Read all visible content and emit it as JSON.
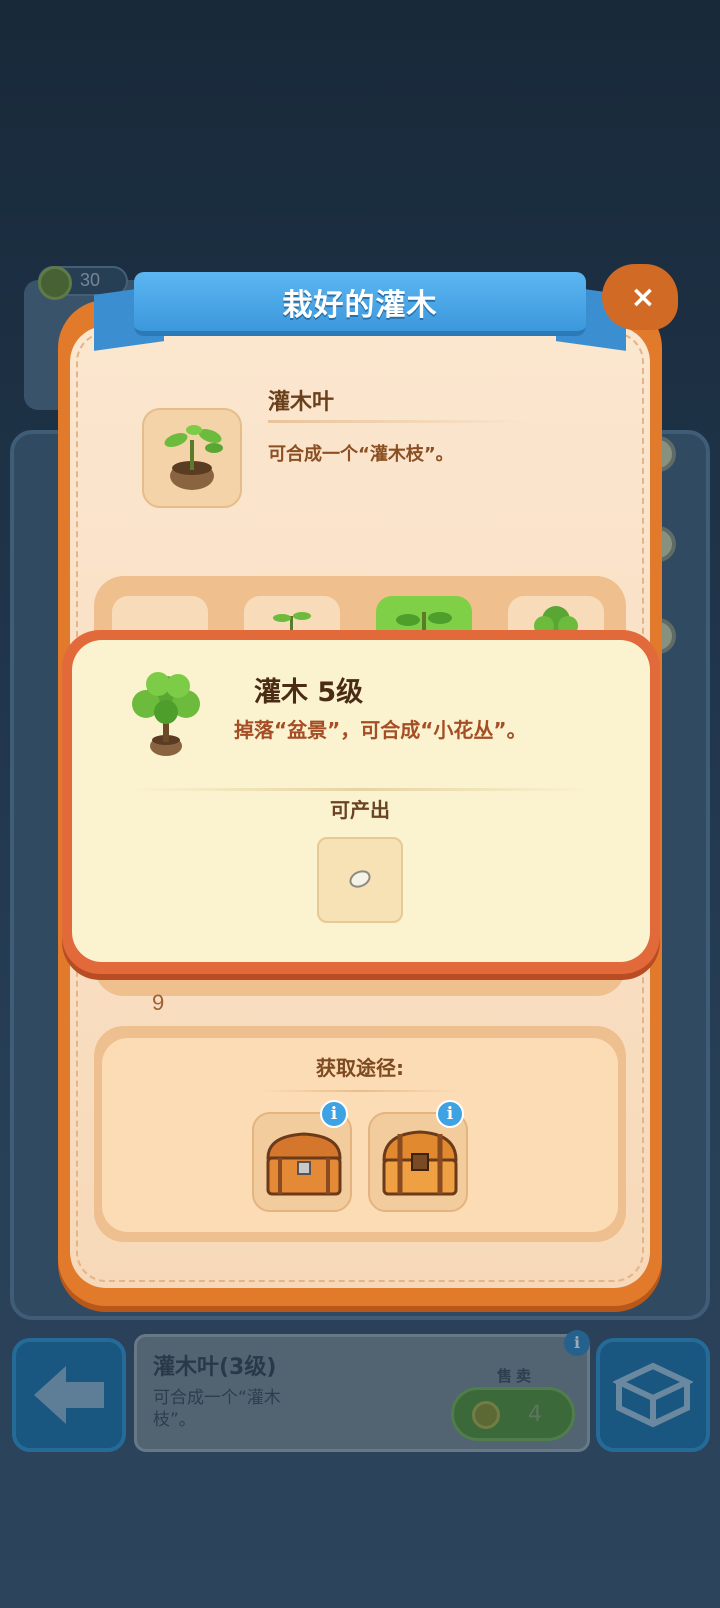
{
  "background": {
    "coin_value": "30",
    "bottom_bar": {
      "item_title": "灌木叶(3级)",
      "item_desc": "可合成一个“灌木枝”。",
      "sell_label": "售卖",
      "sell_price": "4",
      "info_badge": "i"
    }
  },
  "modal": {
    "title": "栽好的灌木",
    "close_label": "×",
    "item": {
      "name": "灌木叶",
      "description": "可合成一个“灌木枝”。"
    },
    "chain_count": "9",
    "source": {
      "title": "获取途径:",
      "badge": "i"
    }
  },
  "popup": {
    "title": "灌木  5级",
    "description": "掉落“盆景”，可合成“小花丛”。",
    "produce_label": "可产出"
  },
  "colors": {
    "modal_orange": "#e27a2c",
    "ribbon_blue": "#3c98dc",
    "popup_cream": "#fbf3d0",
    "active_slot_green": "#7fd047"
  },
  "icons": [
    "house-icon",
    "clock-icon",
    "back-arrow-icon",
    "box-icon",
    "coin-icon",
    "close-icon",
    "potted-sprout-icon",
    "potted-shrub-icon",
    "seed-icon",
    "treasure-chest-icon",
    "info-icon"
  ]
}
